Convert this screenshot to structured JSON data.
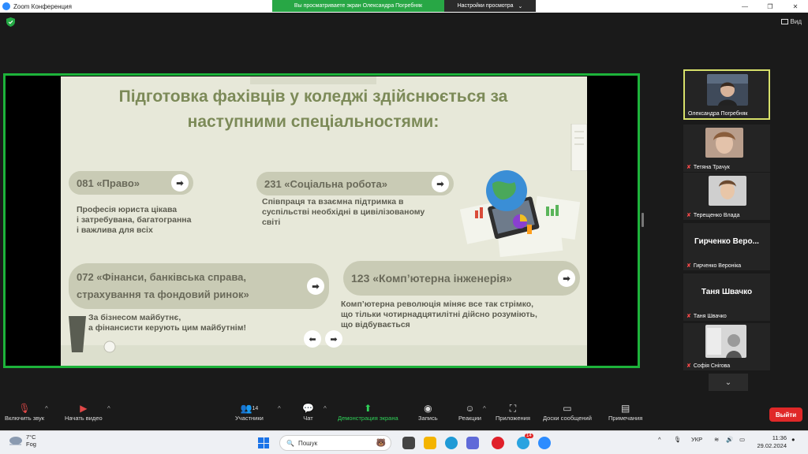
{
  "window": {
    "title": "Zoom Конференция",
    "share_banner": "Вы просматриваете экран Олександра Погребняк",
    "view_settings": "Настройки просмотра",
    "view_button": "Вид"
  },
  "slide": {
    "title_line1": "Підготовка фахівців у коледжі здійснюється за",
    "title_line2": "наступними спеціальностями:",
    "spec1": {
      "label": "081 «Право»",
      "desc_line1": "Професія юриста цікава",
      "desc_line2": "і затребувана, багатогранна",
      "desc_line3": "і важлива для всіх"
    },
    "spec2": {
      "label": "231 «Соціальна робота»",
      "desc_line1": "Співпраця та взаємна підтримка в",
      "desc_line2": "суспільстві необхідні в цивілізованому",
      "desc_line3": "світі"
    },
    "spec3": {
      "label_line1": "072 «Фінанси, банківська справа,",
      "label_line2": "страхування та фондовий ринок»",
      "desc_line1": "За бізнесом майбутнє,",
      "desc_line2": "а фінансисти керують цим майбутнім!"
    },
    "spec4": {
      "label": "123 «Комп’ютерна інженерія»",
      "desc_line1": "Комп’ютерна революція міняє все так стрімко,",
      "desc_line2": "що тільки чотирнадцятилітні дійсно розуміють,",
      "desc_line3": "що відбувається"
    }
  },
  "participants": [
    {
      "name": "Олександра Погребняк",
      "active": true,
      "muted": false
    },
    {
      "name": "Тетяна Трачук",
      "muted": true
    },
    {
      "name": "Терещенко Влада",
      "muted": true
    },
    {
      "name": "Гирченко Вероніка",
      "display": "Гирченко Веро...",
      "muted": true
    },
    {
      "name": "Таня Швачко",
      "display": "Таня Швачко",
      "muted": true
    },
    {
      "name": "Софія Снігова",
      "muted": true
    }
  ],
  "toolbar": {
    "audio": "Включить звук",
    "video": "Начать видео",
    "participants": "Участники",
    "participants_count": "14",
    "chat": "Чат",
    "share": "Демонстрация экрана",
    "record": "Запись",
    "reactions": "Реакции",
    "apps": "Приложения",
    "whiteboards": "Доски сообщений",
    "notes": "Примечания",
    "leave": "Выйти"
  },
  "taskbar": {
    "temp": "7°C",
    "weather": "Fog",
    "search_placeholder": "Пошук",
    "lang": "УКР",
    "time": "11:36",
    "date": "29.02.2024",
    "badge": "14"
  },
  "colors": {
    "share_green": "#1db33a",
    "slide_title": "#7c8a58",
    "leave_red": "#e02828"
  }
}
